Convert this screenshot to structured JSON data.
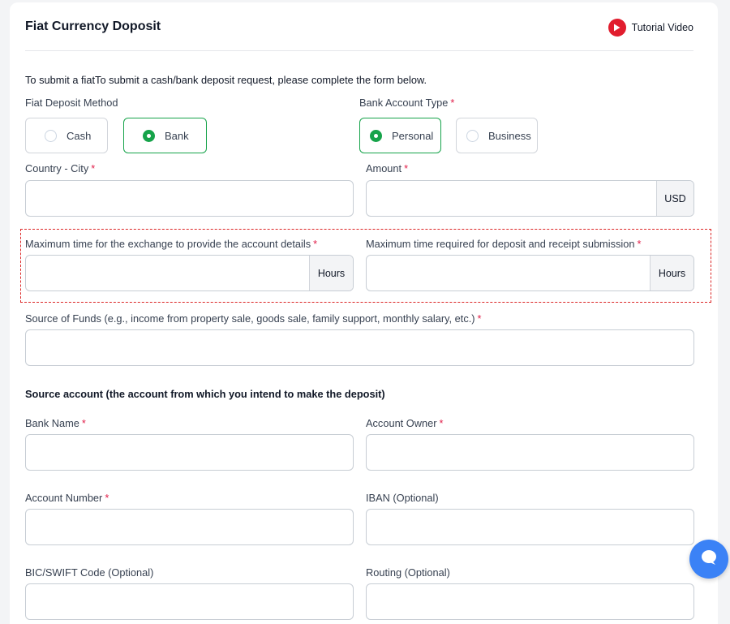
{
  "header": {
    "title": "Fiat Currency Doposit",
    "tutorial_label": "Tutorial Video"
  },
  "intro": "To submit a fiatTo submit a cash/bank deposit request, please complete the form below.",
  "deposit_method": {
    "label": "Fiat Deposit Method",
    "options": [
      {
        "label": "Cash",
        "selected": false
      },
      {
        "label": "Bank",
        "selected": true
      }
    ]
  },
  "account_type": {
    "label": "Bank Account Type",
    "required_mark": "*",
    "options": [
      {
        "label": "Personal",
        "selected": true
      },
      {
        "label": "Business",
        "selected": false
      }
    ]
  },
  "country_city": {
    "label": "Country - City",
    "required_mark": "*",
    "value": ""
  },
  "amount": {
    "label": "Amount",
    "required_mark": "*",
    "value": "",
    "suffix": "USD"
  },
  "exchange_time": {
    "label": "Maximum time for the exchange to provide the account details",
    "required_mark": "*",
    "value": "",
    "suffix": "Hours"
  },
  "deposit_time": {
    "label": "Maximum time required for deposit and receipt submission",
    "required_mark": "*",
    "value": "",
    "suffix": "Hours"
  },
  "source_of_funds": {
    "label": "Source of Funds (e.g., income from property sale, goods sale, family support, monthly salary, etc.)",
    "required_mark": "*",
    "value": ""
  },
  "source_account_heading": "Source account (the account from which you intend to make the deposit)",
  "bank_name": {
    "label": "Bank Name",
    "required_mark": "*",
    "value": ""
  },
  "account_owner": {
    "label": "Account Owner",
    "required_mark": "*",
    "value": ""
  },
  "account_number": {
    "label": "Account Number",
    "required_mark": "*",
    "value": ""
  },
  "iban": {
    "label": "IBAN (Optional)",
    "value": ""
  },
  "bic_swift": {
    "label": "BIC/SWIFT Code (Optional)",
    "value": ""
  },
  "routing": {
    "label": "Routing (Optional)",
    "value": ""
  },
  "colors": {
    "accent": "#16a34a",
    "required": "#e11d48",
    "highlight_border": "#dc2626",
    "chat_button": "#3b82f6",
    "youtube_red": "#e11d2e"
  },
  "icons": {
    "tutorial": "youtube-play-icon",
    "chat": "chat-bubble-icon"
  }
}
